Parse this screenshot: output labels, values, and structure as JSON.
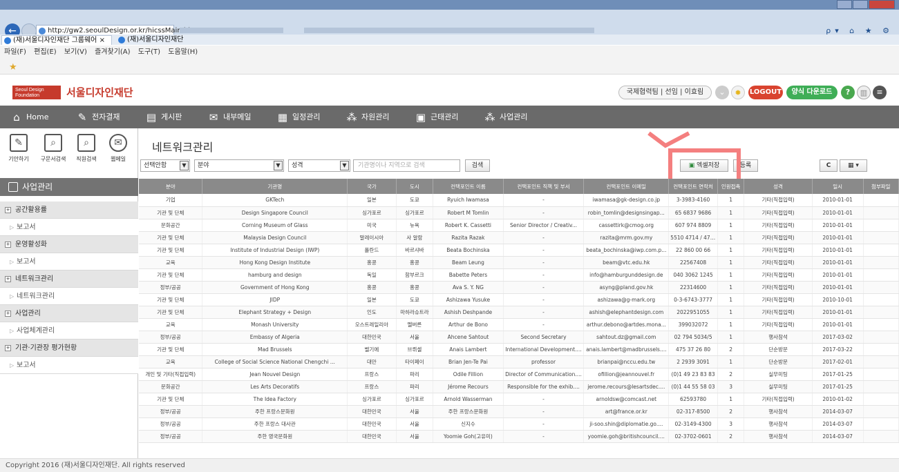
{
  "browser": {
    "url": "http://gw2.seoulDesign.or.kr/hicssMain.hi#",
    "tabs": [
      "(재)서울디자인재단 그룹웨어",
      "(재)서울디자인재단"
    ],
    "menu": [
      "파일(F)",
      "편집(E)",
      "보기(V)",
      "즐겨찾기(A)",
      "도구(T)",
      "도움말(H)"
    ]
  },
  "header": {
    "logo_text": "서울디자인재단",
    "logo_box": "Seoul Design Foundation",
    "user": "국제협력팀 | 선임 | 이효림",
    "logout": "LOGOUT",
    "download": "양식 다운로드"
  },
  "nav": [
    "Home",
    "전자결재",
    "게시판",
    "내부메일",
    "일정관리",
    "자원관리",
    "근태관리",
    "사업관리"
  ],
  "quick": [
    "기안하기",
    "구문서검색",
    "직원검색",
    "웹메일"
  ],
  "sidebar": {
    "title": "사업관리",
    "items": [
      {
        "label": "공간활용률",
        "type": "main"
      },
      {
        "label": "보고서",
        "type": "sub"
      },
      {
        "label": "운영활성화",
        "type": "main"
      },
      {
        "label": "보고서",
        "type": "sub"
      },
      {
        "label": "네트워크관리",
        "type": "main"
      },
      {
        "label": "네트워크관리",
        "type": "sub"
      },
      {
        "label": "사업관리",
        "type": "main"
      },
      {
        "label": "사업체계관리",
        "type": "sub"
      },
      {
        "label": "기관·기관장 평가현황",
        "type": "main"
      },
      {
        "label": "보고서",
        "type": "sub"
      }
    ]
  },
  "main": {
    "title": "네트워크관리",
    "filters": {
      "select1": "선택안함",
      "select2": "분야",
      "select3": "성격"
    },
    "search_placeholder": "기관명이나 지역으로 검색",
    "search_btn": "검색",
    "excel_btn": "엑셀저장",
    "register_btn": "등록",
    "refresh": "C",
    "grid_icon": "▦ ▾",
    "columns": [
      "분야",
      "기관명",
      "국가",
      "도시",
      "컨택포인트 이름",
      "컨택포인트 직책 및 부서",
      "컨택포인트 이메일",
      "컨택포인트 연락처",
      "인원접촉",
      "성격",
      "일시",
      "첨부파일"
    ],
    "rows": [
      [
        "기업",
        "GKTech",
        "일본",
        "도쿄",
        "Ryuich Iwamasa",
        "-",
        "iwamasa@gk-design.co.jp",
        "3-3983-4160",
        "1",
        "기타(직접입력)",
        "2010-01-01",
        ""
      ],
      [
        "기관 및 단체",
        "Design Singapore Council",
        "싱가포르",
        "싱가포르",
        "Robert M Tomlin",
        "-",
        "robin_tomlin@designsingap...",
        "65 6837 9686",
        "1",
        "기타(직접입력)",
        "2010-01-01",
        ""
      ],
      [
        "문화공간",
        "Corning Museum of Glass",
        "미국",
        "뉴욕",
        "Robert K. Cassetti",
        "Senior Director / Creativ...",
        "cassettirk@cmog.org",
        "607 974 8809",
        "1",
        "기타(직접입력)",
        "2010-01-01",
        ""
      ],
      [
        "기관 및 단체",
        "Malaysia Design Council",
        "말레이시아",
        "사 알람",
        "Razita Razak",
        "-",
        "razita@mrm.gov.my",
        "5510 4714 / 4717",
        "1",
        "기타(직접입력)",
        "2010-01-01",
        ""
      ],
      [
        "기관 및 단체",
        "Institute of Industrial Design (IWP)",
        "폴란드",
        "바르샤바",
        "Beata Bochinska",
        "-",
        "beata_bochinska@iwp.com.p...",
        "22 860 00 66",
        "1",
        "기타(직접입력)",
        "2010-01-01",
        ""
      ],
      [
        "교육",
        "Hong Kong Design Institute",
        "홍콩",
        "홍콩",
        "Beam Leung",
        "-",
        "beam@vtc.edu.hk",
        "22567408",
        "1",
        "기타(직접입력)",
        "2010-01-01",
        ""
      ],
      [
        "기관 및 단체",
        "hamburg and design",
        "독일",
        "함부르크",
        "Babette Peters",
        "-",
        "info@hamburgunddesign.de",
        "040 3062 1245",
        "1",
        "기타(직접입력)",
        "2010-01-01",
        ""
      ],
      [
        "정부/공공",
        "Government of Hong Kong",
        "홍콩",
        "홍콩",
        "Ava S. Y. NG",
        "-",
        "asyng@pland.gov.hk",
        "22314600",
        "1",
        "기타(직접입력)",
        "2010-01-01",
        ""
      ],
      [
        "기관 및 단체",
        "JIDP",
        "일본",
        "도쿄",
        "Ashizawa Yusuke",
        "-",
        "ashizawa@g-mark.org",
        "0-3-6743-3777",
        "1",
        "기타(직접입력)",
        "2010-10-01",
        ""
      ],
      [
        "기관 및 단체",
        "Elephant Strategy + Design",
        "인도",
        "마하라슈트라",
        "Ashish Deshpande",
        "-",
        "ashish@elephantdesign.com",
        "2022951055",
        "1",
        "기타(직접입력)",
        "2010-01-01",
        ""
      ],
      [
        "교육",
        "Monash University",
        "오스트레일리아",
        "멜버른",
        "Arthur de Bono",
        "-",
        "arthur.debono@artdes.mona...",
        "399032072",
        "1",
        "기타(직접입력)",
        "2010-01-01",
        ""
      ],
      [
        "정부/공공",
        "Embassy of Algeria",
        "대한민국",
        "서울",
        "Ahcene Sahtout",
        "Second Secretary",
        "sahtout.dz@gmail.com",
        "02 794 5034/5",
        "1",
        "행사참석",
        "2017-03-02",
        ""
      ],
      [
        "기관 및 단체",
        "Mad Brussels",
        "벨기에",
        "브뤼셀",
        "Anais Lambert",
        "International Development....",
        "anais.lambert@madbrussels....",
        "475 37 26 80",
        "2",
        "단순방문",
        "2017-03-22",
        ""
      ],
      [
        "교육",
        "College of Social Science National Chengchi ...",
        "대만",
        "타이페이",
        "Brian Jen-Te Pai",
        "professor",
        "brianpai@nccu.edu.tw",
        "2 2939 3091",
        "1",
        "단순방문",
        "2017-02-01",
        ""
      ],
      [
        "개인 및 기타(직접입력)",
        "Jean Nouvel Design",
        "프랑스",
        "파리",
        "Odile Fillion",
        "Director of Communication....",
        "ofillion@jeannouvel.fr",
        "(0)1 49 23 83 83",
        "2",
        "실무미팅",
        "2017-01-25",
        ""
      ],
      [
        "문화공간",
        "Les Arts Decoratifs",
        "프랑스",
        "파리",
        "Jérome Recours",
        "Responsible for the exhib....",
        "jerome.recours@lesartsdec....",
        "(0)1 44 55 58 03",
        "3",
        "실무미팅",
        "2017-01-25",
        ""
      ],
      [
        "기관 및 단체",
        "The Idea Factory",
        "싱가포르",
        "싱가포르",
        "Arnold Wasserman",
        "-",
        "arnoldsw@comcast.net",
        "62593780",
        "1",
        "기타(직접입력)",
        "2010-01-02",
        ""
      ],
      [
        "정부/공공",
        "주한 프랑스문화원",
        "대한민국",
        "서울",
        "주한 프랑스문화원",
        "-",
        "art@france.or.kr",
        "02-317-8500",
        "2",
        "행사참석",
        "2014-03-07",
        ""
      ],
      [
        "정부/공공",
        "주한 프랑스 대사관",
        "대한민국",
        "서울",
        "신지수",
        "-",
        "ji-soo.shin@diplomatie.go....",
        "02-3149-4300",
        "3",
        "행사참석",
        "2014-03-07",
        ""
      ],
      [
        "정부/공공",
        "주한 영국문화원",
        "대한민국",
        "서울",
        "Yoomie Goh(고유미)",
        "-",
        "yoomie.goh@britishcouncil....",
        "02-3702-0601",
        "2",
        "행사참석",
        "2014-03-07",
        ""
      ]
    ]
  },
  "footer": "Copyright 2016 (재)서울디자인재단. All rights reserved",
  "colors": {
    "brand": "#c63a2c",
    "nav": "#6a6a6a",
    "highlight": "#f47f7f",
    "logout": "#d9432f",
    "download": "#3fae57"
  }
}
